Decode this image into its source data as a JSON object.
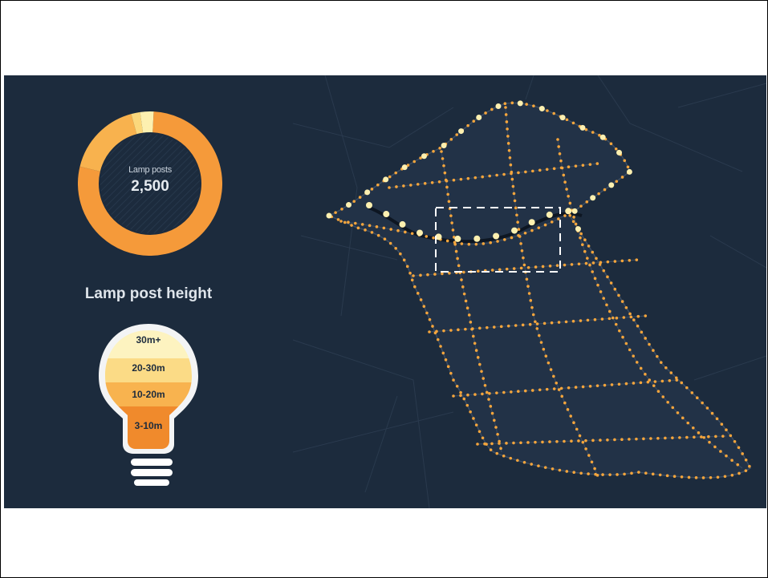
{
  "summary": {
    "donut_label": "Lamp posts",
    "donut_value": "2,500",
    "segments": [
      {
        "label": "3-10m",
        "fraction": 0.78,
        "color": "#f59a3a"
      },
      {
        "label": "10-20m",
        "fraction": 0.17,
        "color": "#f8b24e"
      },
      {
        "label": "20-30m",
        "fraction": 0.02,
        "color": "#fbd87c"
      },
      {
        "label": "30m+",
        "fraction": 0.03,
        "color": "#fdf0b0"
      }
    ]
  },
  "legend": {
    "title": "Lamp post height",
    "bands": [
      {
        "label": "30m+",
        "color": "#fdf3c0"
      },
      {
        "label": "20-30m",
        "color": "#fbdb86"
      },
      {
        "label": "10-20m",
        "color": "#f8b34f"
      },
      {
        "label": "3-10m",
        "color": "#f08a2c"
      }
    ]
  },
  "colors": {
    "background": "#1c2b3d",
    "street": "#2e3f53",
    "lamp_small": "#f5a53c",
    "lamp_large": "#fdf0b0"
  }
}
